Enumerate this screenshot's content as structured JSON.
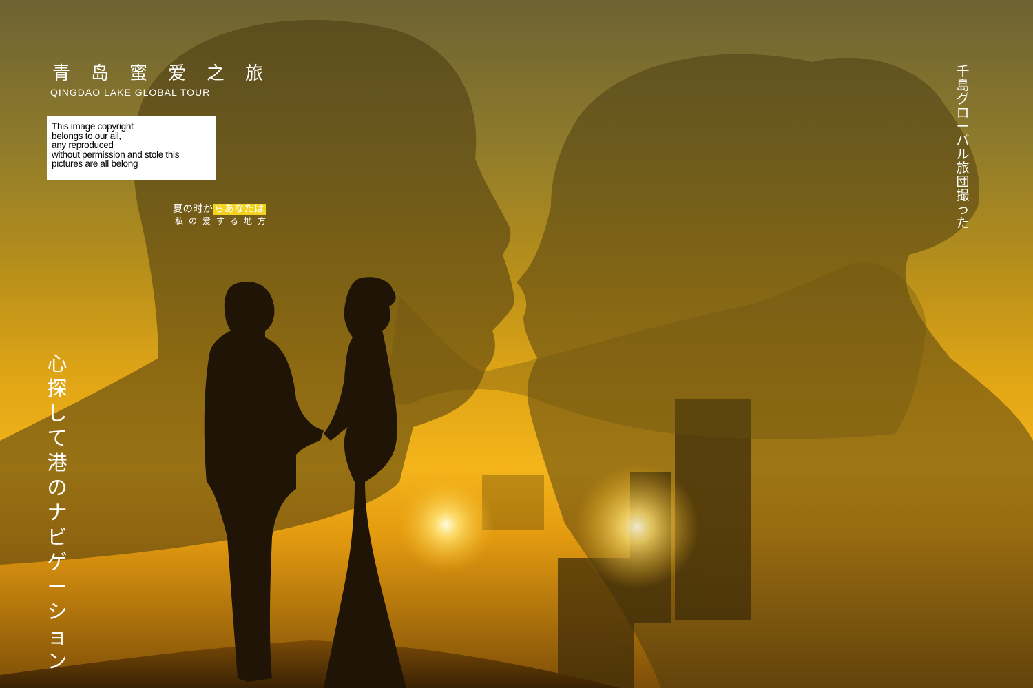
{
  "poster": {
    "title_cn": "青岛蜜爱之旅",
    "title_en": "QINGDAO LAKE GLOBAL TOUR",
    "copyright_lines": [
      "This image copyright",
      "belongs to our all,",
      "any reproduced",
      "without permission and stole this",
      "pictures are all belong"
    ],
    "tagline": {
      "line1_plain": "夏の时か",
      "line1_highlight": "らあなたは",
      "line2": "私の爱する地方"
    },
    "vertical_left": "心探して港のナビゲーション",
    "vertical_right": "千島グローバル旅団撮った",
    "colors": {
      "text": "#ffffff",
      "highlight": "#f3d21c",
      "copyright_bg": "#ffffff"
    }
  }
}
